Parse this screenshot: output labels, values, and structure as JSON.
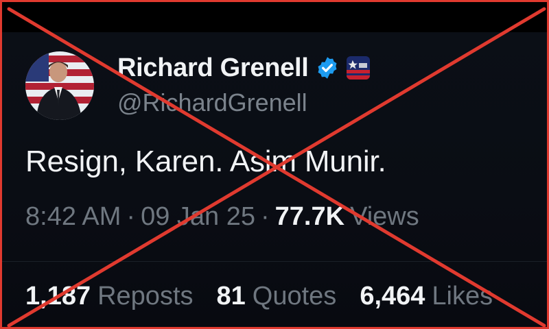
{
  "tweet": {
    "author_name": "Richard Grenell",
    "handle": "@RichardGrenell",
    "text": "Resign, Karen. Asim Munir.",
    "time": "8:42 AM",
    "separator": "·",
    "date": "09 Jan 25",
    "views_count": "77.7K",
    "views_label": "Views"
  },
  "stats": [
    {
      "num": "1,187",
      "label": "Reposts"
    },
    {
      "num": "81",
      "label": "Quotes"
    },
    {
      "num": "6,464",
      "label": "Likes"
    }
  ],
  "icons": {
    "verified": "verified-badge-icon",
    "affiliate": "flag-affiliate-icon"
  },
  "colors": {
    "background": "#05070b",
    "text_primary": "#f1f3f5",
    "text_secondary": "#6f7780",
    "verified_blue": "#1d9bf0",
    "cross_red": "#e03a2f"
  }
}
